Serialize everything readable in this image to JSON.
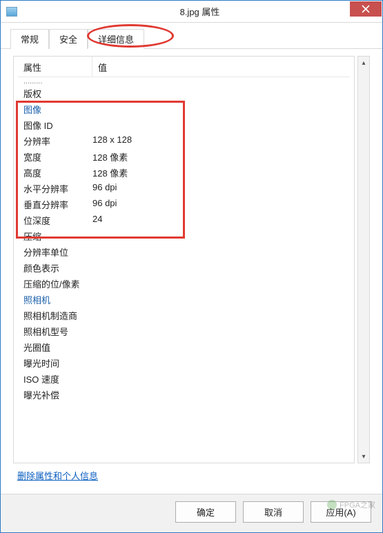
{
  "window": {
    "title": "8.jpg 属性"
  },
  "tabs": {
    "general": "常规",
    "security": "安全",
    "details": "详细信息"
  },
  "headers": {
    "property": "属性",
    "value": "值"
  },
  "rows": {
    "truncated": ".........",
    "copyright": "版权",
    "section_image": "图像",
    "image_id_k": "图像 ID",
    "image_id_v": "",
    "resolution_k": "分辨率",
    "resolution_v": "128 x 128",
    "width_k": "宽度",
    "width_v": "128 像素",
    "height_k": "高度",
    "height_v": "128 像素",
    "hres_k": "水平分辨率",
    "hres_v": "96 dpi",
    "vres_k": "垂直分辨率",
    "vres_v": "96 dpi",
    "bitdepth_k": "位深度",
    "bitdepth_v": "24",
    "compression_k": "压缩",
    "compression_v": "",
    "resunit_k": "分辨率单位",
    "resunit_v": "",
    "colorrep_k": "颜色表示",
    "colorrep_v": "",
    "cbpp_k": "压缩的位/像素",
    "cbpp_v": "",
    "section_camera": "照相机",
    "cammaker_k": "照相机制造商",
    "cammaker_v": "",
    "cammodel_k": "照相机型号",
    "cammodel_v": "",
    "fnum_k": "光圈值",
    "fnum_v": "",
    "exptime_k": "曝光时间",
    "exptime_v": "",
    "iso_k": "ISO 速度",
    "iso_v": "",
    "expcomp_k": "曝光补偿",
    "expcomp_v": ""
  },
  "link": "删除属性和个人信息",
  "buttons": {
    "ok": "确定",
    "cancel": "取消",
    "apply": "应用(A)"
  },
  "watermark": "FPGA之家",
  "scroll": {
    "up": "▴",
    "down": "▾"
  }
}
